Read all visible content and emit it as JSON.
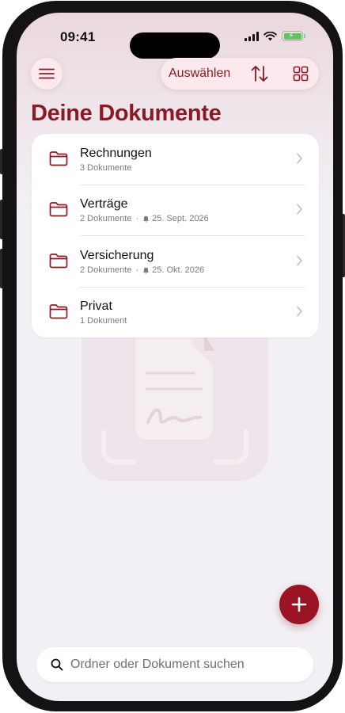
{
  "status_bar": {
    "time": "09:41"
  },
  "toolbar": {
    "select_label": "Auswählen"
  },
  "page": {
    "title": "Deine Dokumente"
  },
  "folders": [
    {
      "name": "Rechnungen",
      "count": "3 Dokumente",
      "reminder": ""
    },
    {
      "name": "Verträge",
      "count": "2 Dokumente",
      "reminder": "25. Sept. 2026"
    },
    {
      "name": "Versicherung",
      "count": "2 Dokumente",
      "reminder": "25. Okt. 2026"
    },
    {
      "name": "Privat",
      "count": "1 Dokument",
      "reminder": ""
    }
  ],
  "search": {
    "placeholder": "Ordner oder Dokument suchen",
    "value": ""
  },
  "colors": {
    "accent": "#8b1a26",
    "fab": "#9a1424",
    "toolbar_bg": "#fbe9ee",
    "battery": "#5cc65c"
  },
  "icons": {
    "menu": "hamburger-icon",
    "sort": "sort-arrows-icon",
    "grid": "grid-view-icon",
    "folder": "folder-icon",
    "reminder": "bell-icon",
    "chevron": "chevron-right-icon",
    "add": "plus-icon",
    "search": "search-icon"
  }
}
